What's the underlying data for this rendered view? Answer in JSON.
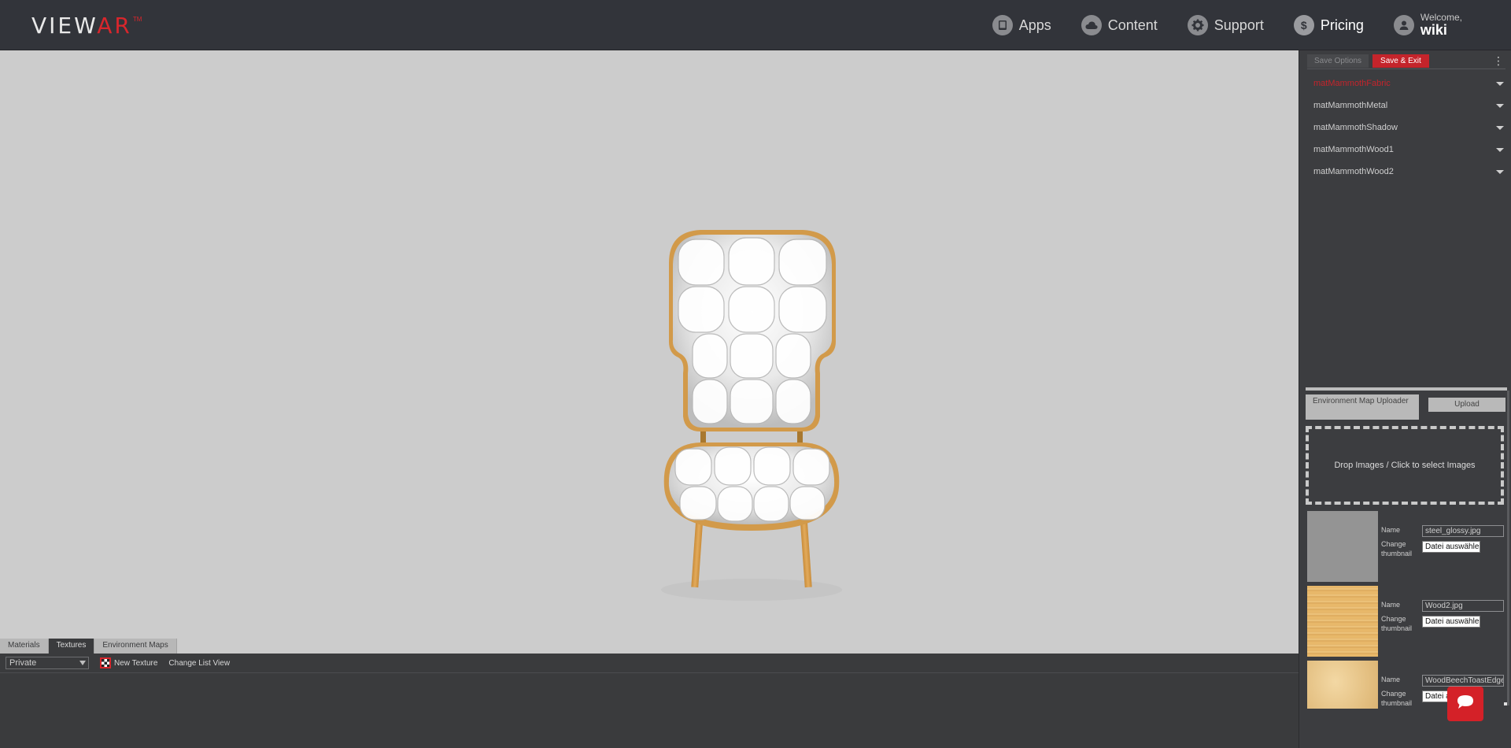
{
  "header": {
    "logo_view": "VIEW",
    "logo_ar": "AR",
    "logo_tm": "TM",
    "nav": [
      {
        "label": "Apps",
        "icon": "tablet-icon"
      },
      {
        "label": "Content",
        "icon": "cloud-icon"
      },
      {
        "label": "Support",
        "icon": "gear-icon"
      },
      {
        "label": "Pricing",
        "icon": "dollar-icon"
      }
    ],
    "welcome_label": "Welcome,",
    "username": "wiki"
  },
  "bottom": {
    "tabs": [
      "Materials",
      "Textures",
      "Environment Maps"
    ],
    "active_tab": "Textures",
    "visibility_value": "Private",
    "new_texture_label": "New Texture",
    "change_view_label": "Change List View"
  },
  "right_panel": {
    "save_options_label": "Save Options",
    "save_exit_label": "Save & Exit",
    "materials": [
      {
        "label": "matMammothFabric",
        "active": true
      },
      {
        "label": "matMammothMetal",
        "active": false
      },
      {
        "label": "matMammothShadow",
        "active": false
      },
      {
        "label": "matMammothWood1",
        "active": false
      },
      {
        "label": "matMammothWood2",
        "active": false
      }
    ],
    "env_uploader_title": "Environment Map Uploader",
    "upload_label": "Upload",
    "dropzone_label": "Drop Images / Click to select Images",
    "name_label": "Name",
    "change_thumb_label": "Change thumbnail",
    "file_button_label": "Datei auswählen",
    "textures": [
      {
        "name": "steel_glossy.jpg"
      },
      {
        "name": "Wood2.jpg"
      },
      {
        "name": "WoodBeechToastEdge"
      }
    ]
  },
  "colors": {
    "brand_red": "#d8262c",
    "header_bg": "#32343a",
    "viewport_bg": "#cccccc"
  }
}
